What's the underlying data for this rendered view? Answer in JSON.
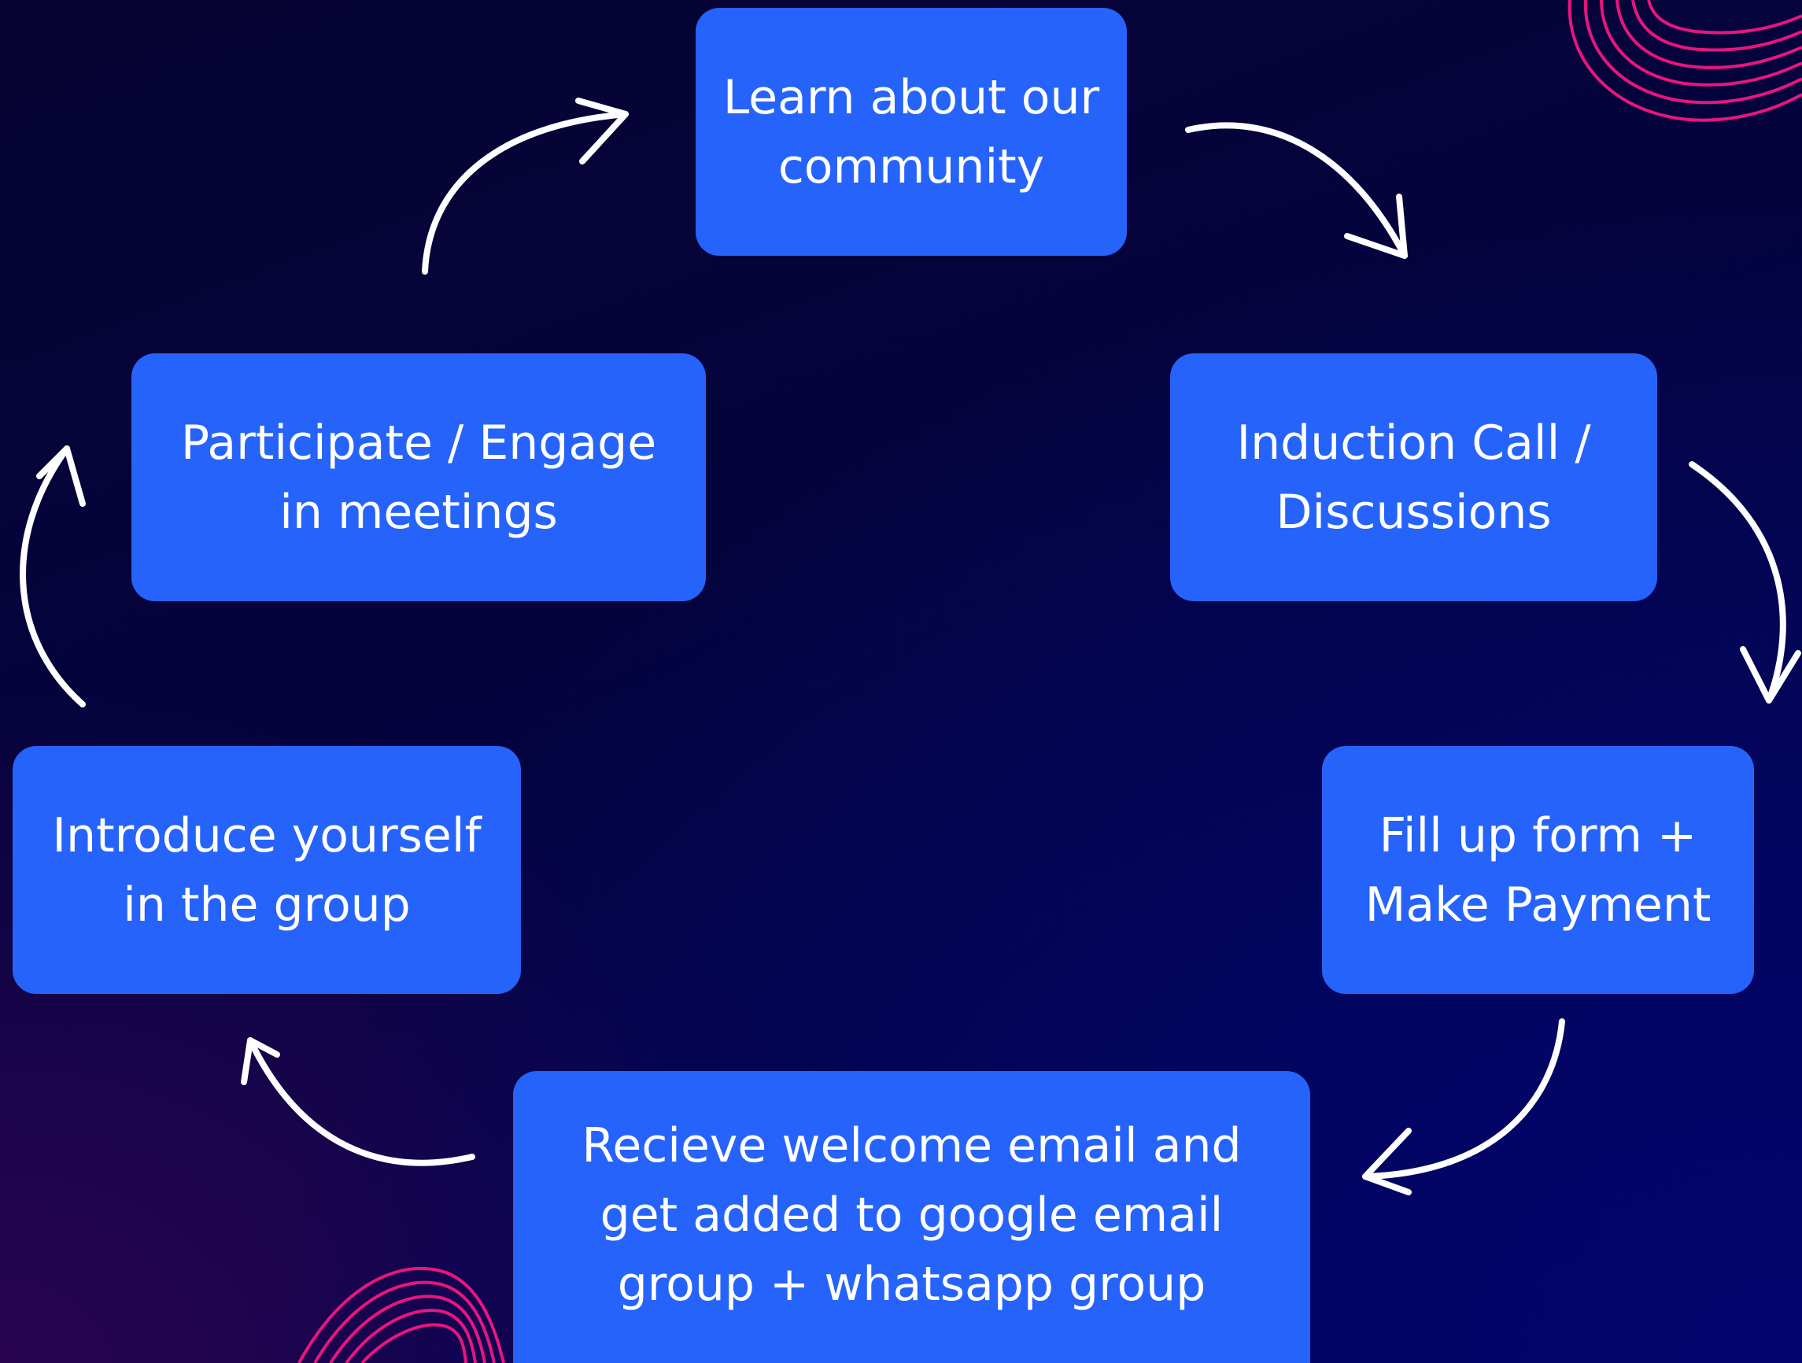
{
  "steps": [
    {
      "id": "learn",
      "label": "Learn about our community"
    },
    {
      "id": "induction",
      "label": "Induction Call / Discussions"
    },
    {
      "id": "form",
      "label": "Fill up form + Make Payment"
    },
    {
      "id": "welcome",
      "label": "Recieve welcome email and get added to google email group + whatsapp group"
    },
    {
      "id": "introduce",
      "label": "Introduce yourself in the group"
    },
    {
      "id": "participate",
      "label": "Participate / Engage in meetings"
    }
  ],
  "colors": {
    "box": "#2563fb",
    "text": "#ffffff",
    "arrow": "#ffffff",
    "accent": "#e8157f"
  }
}
